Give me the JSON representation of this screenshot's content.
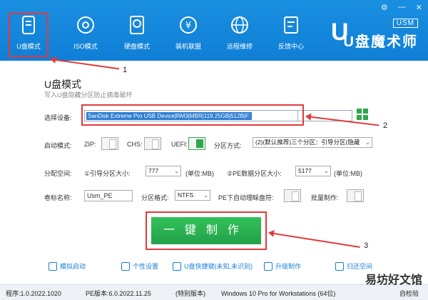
{
  "window": {
    "buttons": [
      "⚙",
      "—",
      "✕"
    ]
  },
  "nav": [
    {
      "label": "U盘模式",
      "icon": "usb-drive-icon"
    },
    {
      "label": "ISO模式",
      "icon": "disc-icon"
    },
    {
      "label": "硬盘模式",
      "icon": "hard-disk-icon"
    },
    {
      "label": "装机联盟",
      "icon": "yuan-circle-icon"
    },
    {
      "label": "远程维修",
      "icon": "globe-icon"
    },
    {
      "label": "反馈中心",
      "icon": "feedback-icon"
    }
  ],
  "logo": {
    "usm": "USM",
    "big": "U盘魔术师",
    "u": "U"
  },
  "annotations": {
    "n1": "1",
    "n2": "2",
    "n3": "3"
  },
  "main": {
    "title": "U盘模式",
    "subtitle": "写入U盘隐藏分区防止病毒破坏",
    "device_label": "选择设备:",
    "device_value": "SanDisk Extreme Pro USB Device|RM3|MBR|119.25GB|512B|F:",
    "boot_mode_label": "启动模式:",
    "zip_label": "ZIP:",
    "chs_label": "CHS:",
    "uefi_label": "UEFI:",
    "partition_mode_label": "分区方式:",
    "partition_mode_value": "(2)(默认推荐)三个分区：引导分区(隐藏",
    "alloc_label": "分配空间:",
    "boot_part_label": "①引导分区大小:",
    "boot_part_value": "777",
    "unit1": "(单位:MB)",
    "pe_part_label": "②PE数据分区大小:",
    "pe_part_value": "5177",
    "unit2": "(单位:MB)",
    "volume_label": "卷标名称:",
    "volume_value": "Usm_PE",
    "fs_label": "分区格式:",
    "fs_value": "NTFS",
    "autoeject_label": "PE下自动理睬盘符:",
    "batch_label": "批量制作:",
    "make_button": "一键制作"
  },
  "footer_links": [
    {
      "label": "模拟启动",
      "icon": "monitor-icon"
    },
    {
      "label": "个性设置",
      "icon": "shirt-icon"
    },
    {
      "label": "U盘快捷键(未知,未识别)",
      "icon": "key-icon"
    },
    {
      "label": "升级制作",
      "icon": "upgrade-icon"
    },
    {
      "label": "归还空间",
      "icon": "space-icon"
    }
  ],
  "status": {
    "program": "程序:1.0.2022.1020",
    "pe": "PE版本:6.0.2022.11.25",
    "edition": "(特别版本)",
    "os": "Windows 10 Pro for Workstations (64位)",
    "check": "自检验"
  },
  "watermark": "易坊好文馆",
  "colors": {
    "header": "#1a8fe0",
    "accent_green": "#2ea84a",
    "annotation_red": "#e23a3a",
    "selection_blue": "#2d7dd2"
  }
}
